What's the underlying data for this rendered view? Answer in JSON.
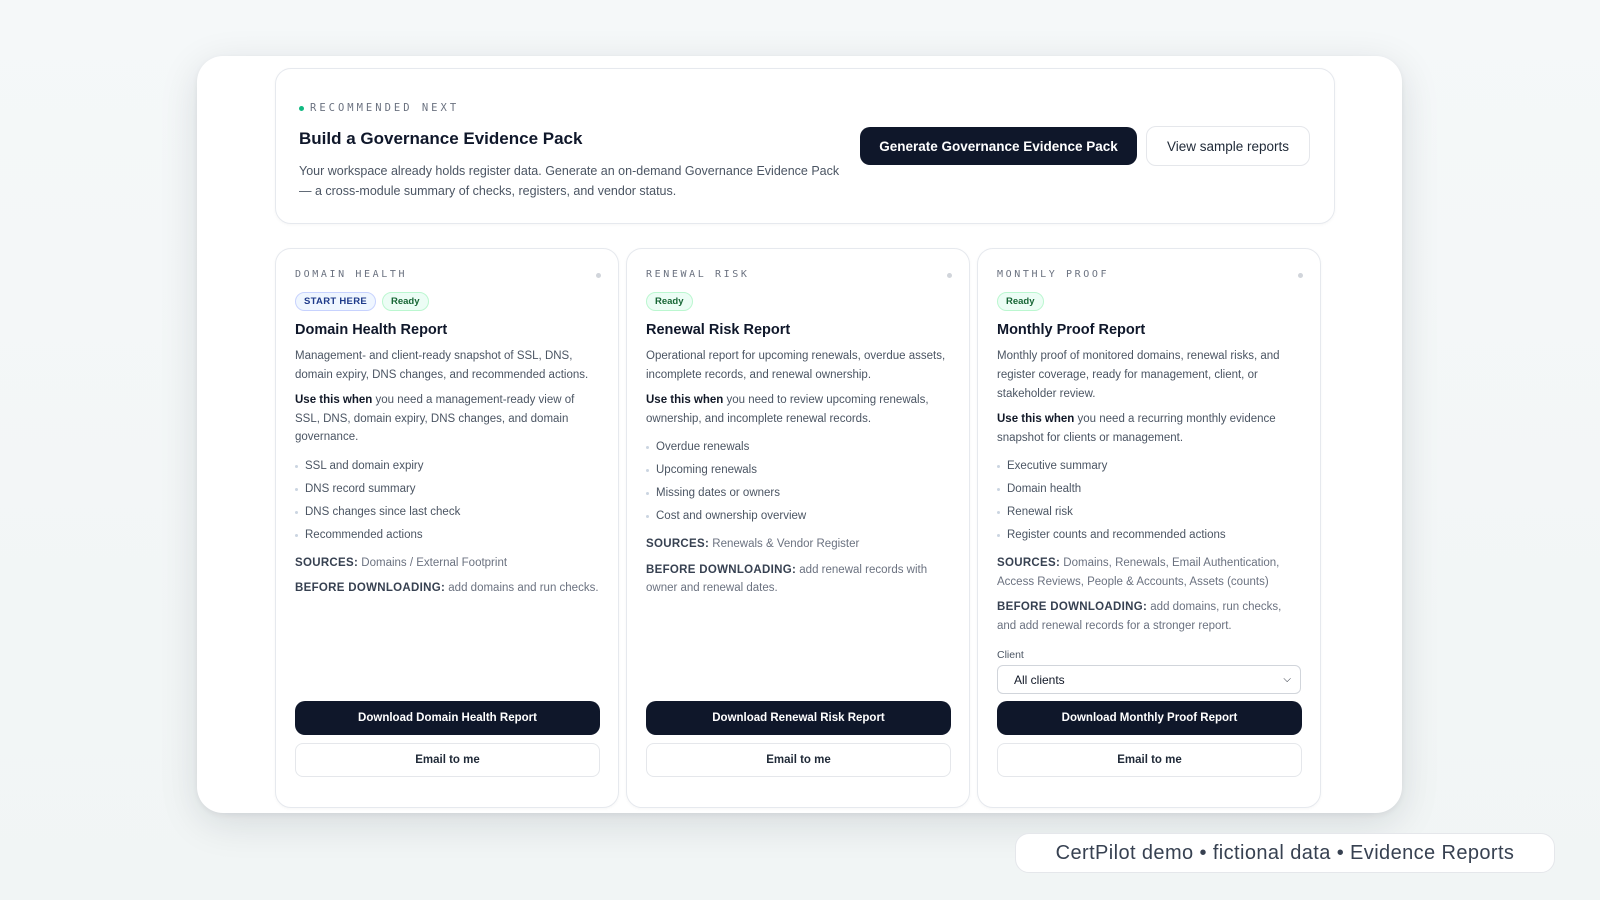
{
  "hero": {
    "eyebrow": "RECOMMENDED NEXT",
    "title": "Build a Governance Evidence Pack",
    "description": "Your workspace already holds register data. Generate an on-demand Governance Evidence Pack — a cross-module summary of checks, registers, and vendor status.",
    "primary_button": "Generate Governance Evidence Pack",
    "secondary_button": "View sample reports"
  },
  "cards": [
    {
      "eyebrow": "DOMAIN HEALTH",
      "badges": [
        "START HERE",
        "Ready"
      ],
      "title": "Domain Health Report",
      "description": "Management- and client-ready snapshot of SSL, DNS, domain expiry, DNS changes, and recommended actions.",
      "use_when_label": "Use this when",
      "use_when_text": " you need a management-ready view of SSL, DNS, domain expiry, DNS changes, and domain governance.",
      "bullets": [
        "SSL and domain expiry",
        "DNS record summary",
        "DNS changes since last check",
        "Recommended actions"
      ],
      "sources_label": "SOURCES:",
      "sources_text": " Domains / External Footprint",
      "before_label": "BEFORE DOWNLOADING:",
      "before_text": " add domains and run checks.",
      "download_label": "Download Domain Health Report",
      "email_label": "Email to me"
    },
    {
      "eyebrow": "RENEWAL RISK",
      "badges": [
        "Ready"
      ],
      "title": "Renewal Risk Report",
      "description": "Operational report for upcoming renewals, overdue assets, incomplete records, and renewal ownership.",
      "use_when_label": "Use this when",
      "use_when_text": " you need to review upcoming renewals, ownership, and incomplete renewal records.",
      "bullets": [
        "Overdue renewals",
        "Upcoming renewals",
        "Missing dates or owners",
        "Cost and ownership overview"
      ],
      "sources_label": "SOURCES:",
      "sources_text": " Renewals & Vendor Register",
      "before_label": "BEFORE DOWNLOADING:",
      "before_text": " add renewal records with owner and renewal dates.",
      "download_label": "Download Renewal Risk Report",
      "email_label": "Email to me"
    },
    {
      "eyebrow": "MONTHLY PROOF",
      "badges": [
        "Ready"
      ],
      "title": "Monthly Proof Report",
      "description": "Monthly proof of monitored domains, renewal risks, and register coverage, ready for management, client, or stakeholder review.",
      "use_when_label": "Use this when",
      "use_when_text": " you need a recurring monthly evidence snapshot for clients or management.",
      "bullets": [
        "Executive summary",
        "Domain health",
        "Renewal risk",
        "Register counts and recommended actions"
      ],
      "sources_label": "SOURCES:",
      "sources_text": " Domains, Renewals, Email Authentication, Access Reviews, People & Accounts, Assets (counts)",
      "before_label": "BEFORE DOWNLOADING:",
      "before_text": " add domains, run checks, and add renewal records for a stronger report.",
      "client_label": "Client",
      "client_value": "All clients",
      "download_label": "Download Monthly Proof Report",
      "email_label": "Email to me"
    }
  ],
  "footer": "CertPilot demo • fictional data • Evidence Reports"
}
